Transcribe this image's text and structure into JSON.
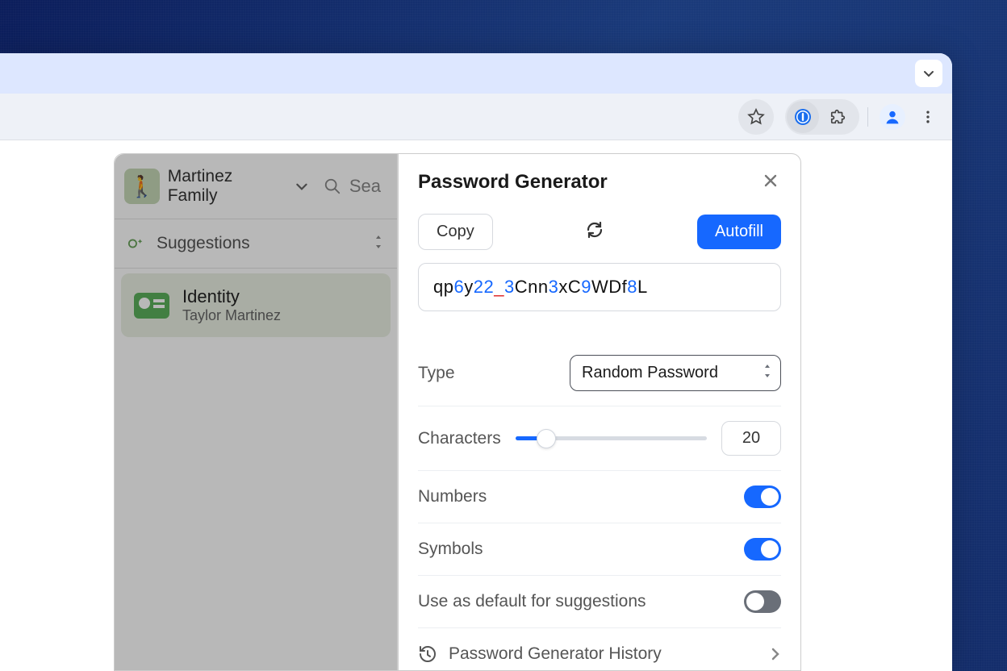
{
  "browser": {
    "toolbar": {
      "star_tooltip": "Bookmark",
      "extensions_tooltip": "Extensions",
      "profile_tooltip": "Profile",
      "menu_tooltip": "Menu"
    }
  },
  "background_popup": {
    "vault_name": "Martinez Family",
    "search_placeholder": "Sea",
    "section_label": "Suggestions",
    "item": {
      "title": "Identity",
      "subtitle": "Taylor Martinez"
    }
  },
  "generator": {
    "title": "Password Generator",
    "copy_label": "Copy",
    "autofill_label": "Autofill",
    "password_segments": [
      {
        "t": "qp",
        "c": "plain"
      },
      {
        "t": "6",
        "c": "digit"
      },
      {
        "t": "y",
        "c": "plain"
      },
      {
        "t": "22",
        "c": "digit"
      },
      {
        "t": "_",
        "c": "sym"
      },
      {
        "t": "3",
        "c": "digit"
      },
      {
        "t": "Cnn",
        "c": "plain"
      },
      {
        "t": "3",
        "c": "digit"
      },
      {
        "t": "xC",
        "c": "plain"
      },
      {
        "t": "9",
        "c": "digit"
      },
      {
        "t": "WDf",
        "c": "plain"
      },
      {
        "t": "8",
        "c": "digit"
      },
      {
        "t": "L",
        "c": "plain"
      }
    ],
    "type_label": "Type",
    "type_value": "Random Password",
    "characters_label": "Characters",
    "characters_value": "20",
    "numbers_label": "Numbers",
    "numbers_on": true,
    "symbols_label": "Symbols",
    "symbols_on": true,
    "default_label": "Use as default for suggestions",
    "default_on": false,
    "history_label": "Password Generator History"
  }
}
